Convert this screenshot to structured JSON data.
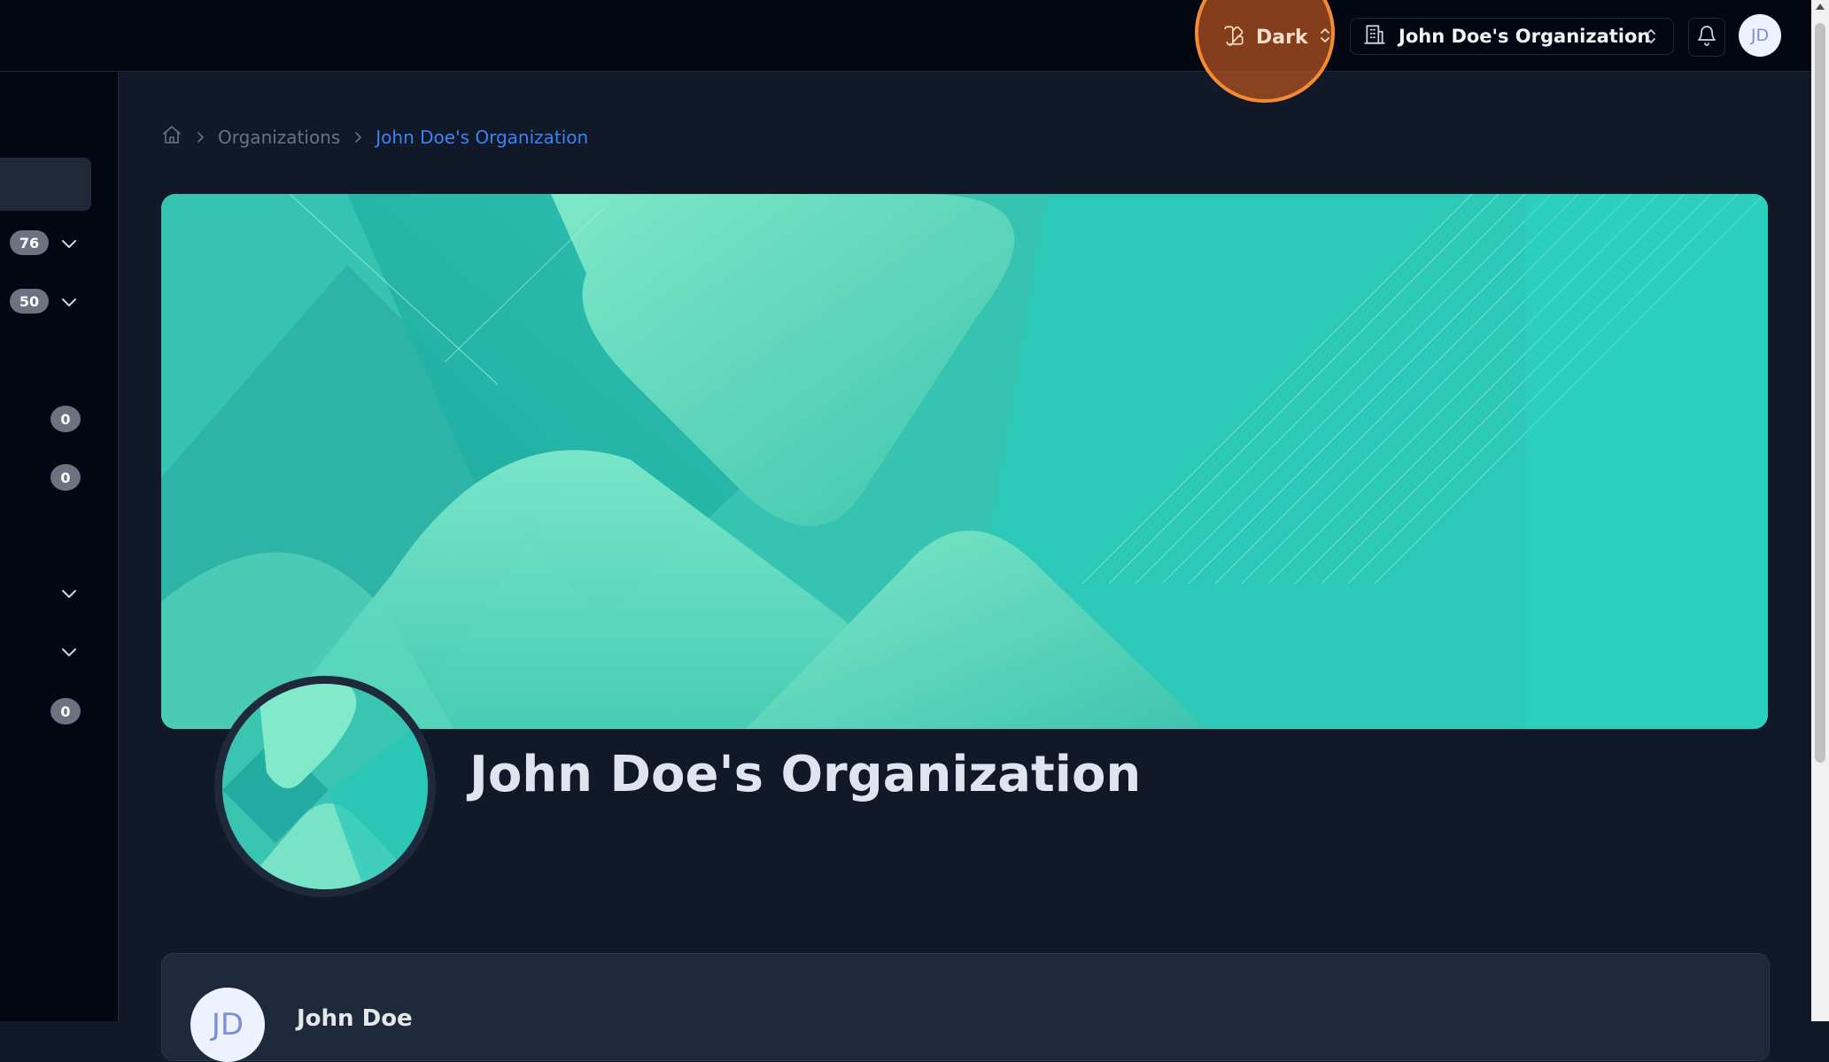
{
  "header": {
    "theme_label": "Dark",
    "org_switcher_label": "John Doe's Organization",
    "user_initials": "JD"
  },
  "sidebar": {
    "counts": [
      "76",
      "50",
      "0",
      "0",
      "0"
    ]
  },
  "breadcrumb": {
    "home_icon": "home-icon",
    "items": [
      "Organizations",
      "John Doe's Organization"
    ]
  },
  "organization": {
    "name": "John Doe's Organization"
  },
  "member": {
    "initials": "JD",
    "name": "John Doe"
  },
  "colors": {
    "accent": "#3b82f6",
    "highlight": "#f28a36",
    "cover_teal": "#2fbfae"
  }
}
